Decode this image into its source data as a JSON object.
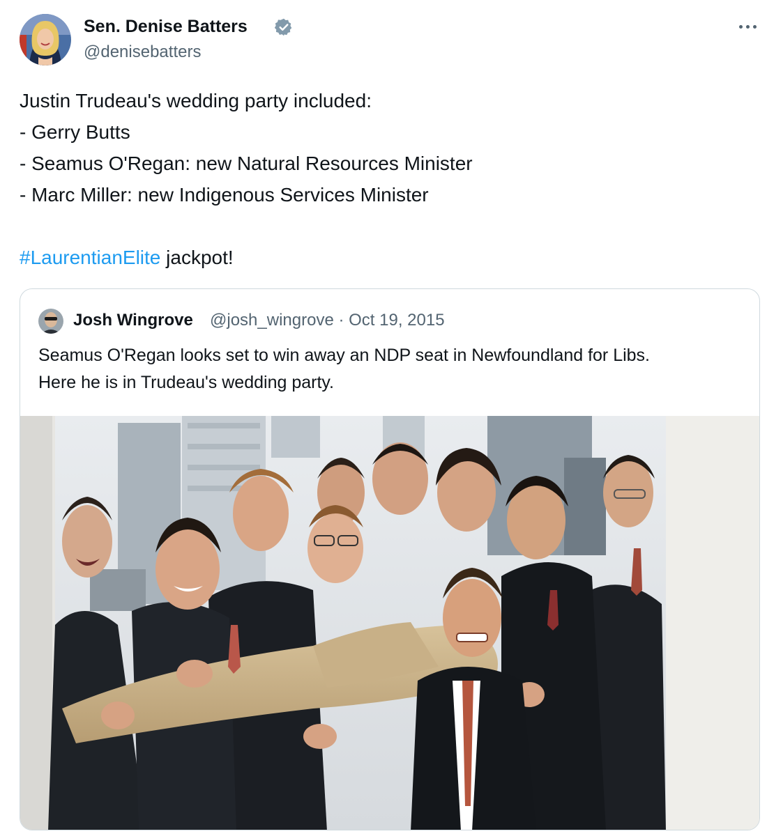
{
  "author": {
    "name": "Sen. Denise Batters",
    "handle": "@denisebatters",
    "verified": true,
    "avatar_icon": "profile-photo"
  },
  "more_icon": "ellipsis-icon",
  "tweet": {
    "lines": [
      "Justin Trudeau's wedding party included:",
      "- Gerry Butts",
      "- Seamus O'Regan: new Natural Resources Minister",
      "- Marc Miller: new Indigenous Services Minister"
    ],
    "hashtag": "#LaurentianElite",
    "hashtag_suffix": " jackpot!"
  },
  "quoted": {
    "name": "Josh Wingrove",
    "handle": "@josh_wingrove",
    "separator": "·",
    "date": "Oct 19, 2015",
    "text_lines": [
      "Seamus O'Regan looks set to win away an NDP seat in Newfoundland for Libs.",
      "Here he is in Trudeau's wedding party."
    ]
  },
  "colors": {
    "text": "#0f1419",
    "secondary": "#536471",
    "link": "#1d9bf0",
    "verified": "#829aab",
    "border": "#cfd9de"
  }
}
